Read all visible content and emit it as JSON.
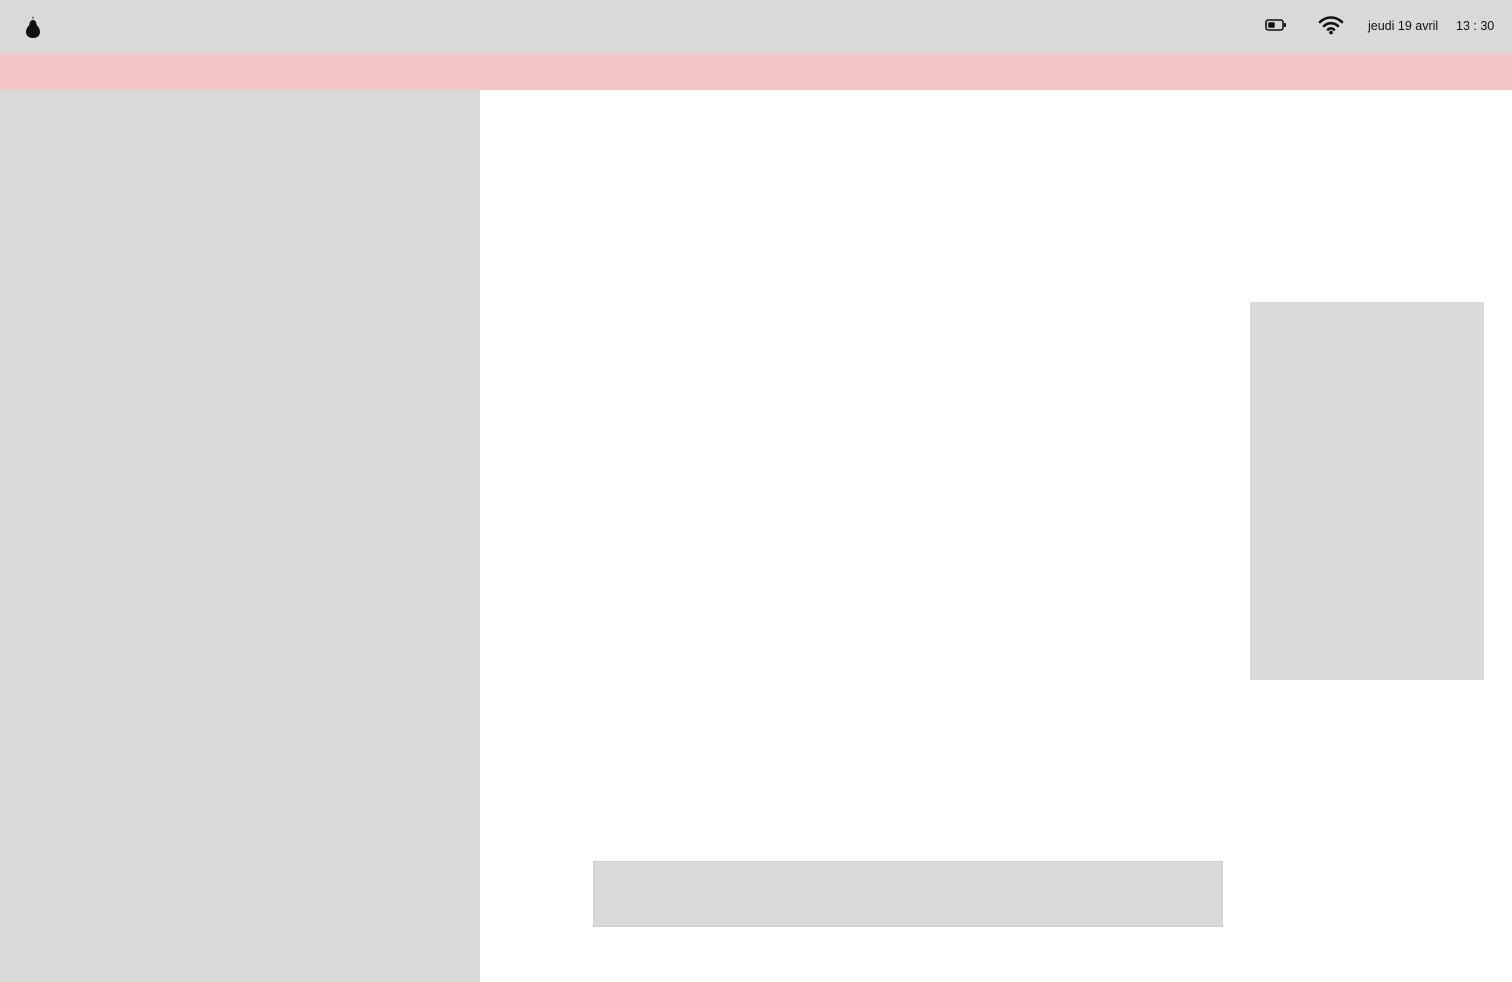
{
  "menubar": {
    "logo_icon": "pear-logo-icon",
    "battery_icon": "battery-icon",
    "wifi_icon": "wifi-icon",
    "date": "jeudi 19 avril",
    "time": "13 : 30"
  },
  "colors": {
    "menubar_bg": "#d9d9d9",
    "banner_bg": "#f4c6c8",
    "sidebar_bg": "#d9d9d9",
    "main_bg": "#ffffff",
    "placeholder_bg": "#d9d9d9"
  }
}
